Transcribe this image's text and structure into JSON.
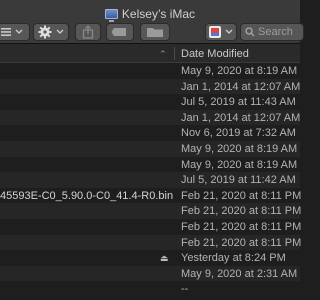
{
  "window": {
    "title": "Kelsey’s iMac"
  },
  "toolbar": {
    "search_placeholder": "Search"
  },
  "columns": {
    "date_modified": "Date Modified",
    "sort_indicator": "⌃"
  },
  "rows": [
    {
      "name": "",
      "date": "May 9, 2020 at 8:19 AM"
    },
    {
      "name": "",
      "date": "Jan 1, 2014 at 12:07 AM"
    },
    {
      "name": "",
      "date": "Jul 5, 2019 at 11:43 AM"
    },
    {
      "name": "",
      "date": "Jan 1, 2014 at 12:07 AM"
    },
    {
      "name": "",
      "date": "Nov 6, 2019 at 7:32 AM"
    },
    {
      "name": "",
      "date": "May 9, 2020 at 8:19 AM"
    },
    {
      "name": "",
      "date": "May 9, 2020 at 8:19 AM"
    },
    {
      "name": "",
      "date": "Jul 5, 2019 at 11:42 AM"
    },
    {
      "name": "45593E-C0_5.90.0-C0_41.4-R0.bin",
      "date": "Feb 21, 2020 at 8:11 PM"
    },
    {
      "name": "",
      "date": "Feb 21, 2020 at 8:11 PM"
    },
    {
      "name": "",
      "date": "Feb 21, 2020 at 8:11 PM"
    },
    {
      "name": "",
      "date": "Feb 21, 2020 at 8:11 PM"
    },
    {
      "name": "",
      "date": "Yesterday at 8:24 PM",
      "eject": "⏏"
    },
    {
      "name": "",
      "date": "May 9, 2020 at 2:31 AM"
    },
    {
      "name": "",
      "date": "--"
    }
  ]
}
